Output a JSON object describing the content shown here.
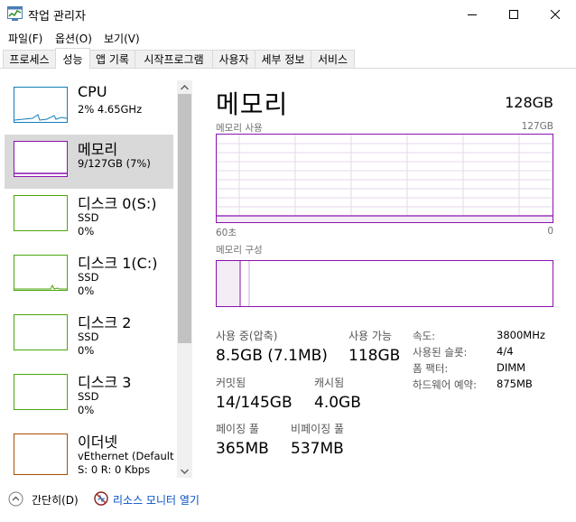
{
  "window": {
    "title": "작업 관리자"
  },
  "menu": {
    "items": [
      "파일(F)",
      "옵션(O)",
      "보기(V)"
    ]
  },
  "tabs": [
    "프로세스",
    "성능",
    "앱 기록",
    "시작프로그램",
    "사용자",
    "세부 정보",
    "서비스"
  ],
  "sidebar": {
    "items": [
      {
        "title": "CPU",
        "sub1": "2% 4.65GHz",
        "sub2": "",
        "sub3": ""
      },
      {
        "title": "메모리",
        "sub1": "9/127GB (7%)",
        "sub2": "",
        "sub3": ""
      },
      {
        "title": "디스크 0(S:)",
        "sub1": "SSD",
        "sub2": "0%",
        "sub3": ""
      },
      {
        "title": "디스크 1(C:)",
        "sub1": "SSD",
        "sub2": "0%",
        "sub3": ""
      },
      {
        "title": "디스크 2",
        "sub1": "SSD",
        "sub2": "0%",
        "sub3": ""
      },
      {
        "title": "디스크 3",
        "sub1": "SSD",
        "sub2": "0%",
        "sub3": ""
      },
      {
        "title": "이더넷",
        "sub1": "vEthernet (Default S",
        "sub2": "S: 0  R: 0 Kbps",
        "sub3": ""
      }
    ]
  },
  "main": {
    "title": "메모리",
    "total": "128GB",
    "usage_label": "메모리 사용",
    "usage_max": "127GB",
    "time_left": "60초",
    "time_right": "0",
    "composition_label": "메모리 구성",
    "stats": {
      "in_use_label": "사용 중(압축)",
      "in_use_value": "8.5GB (7.1MB)",
      "available_label": "사용 가능",
      "available_value": "118GB",
      "committed_label": "커밋됨",
      "committed_value": "14/145GB",
      "cached_label": "캐시됨",
      "cached_value": "4.0GB",
      "paged_label": "페이징 풀",
      "paged_value": "365MB",
      "nonpaged_label": "비페이징 풀",
      "nonpaged_value": "537MB"
    },
    "details": [
      {
        "label": "속도:",
        "value": "3800MHz"
      },
      {
        "label": "사용된 슬롯:",
        "value": "4/4"
      },
      {
        "label": "폼 팩터:",
        "value": "DIMM"
      },
      {
        "label": "하드웨어 예약:",
        "value": "875MB"
      }
    ]
  },
  "footer": {
    "less_details": "간단히(D)",
    "resource_monitor": "리소스 모니터 열기"
  },
  "colors": {
    "memory": "#8b12ae",
    "cpu": "#117dbb",
    "disk": "#4da60c",
    "ethernet": "#a74f01"
  }
}
